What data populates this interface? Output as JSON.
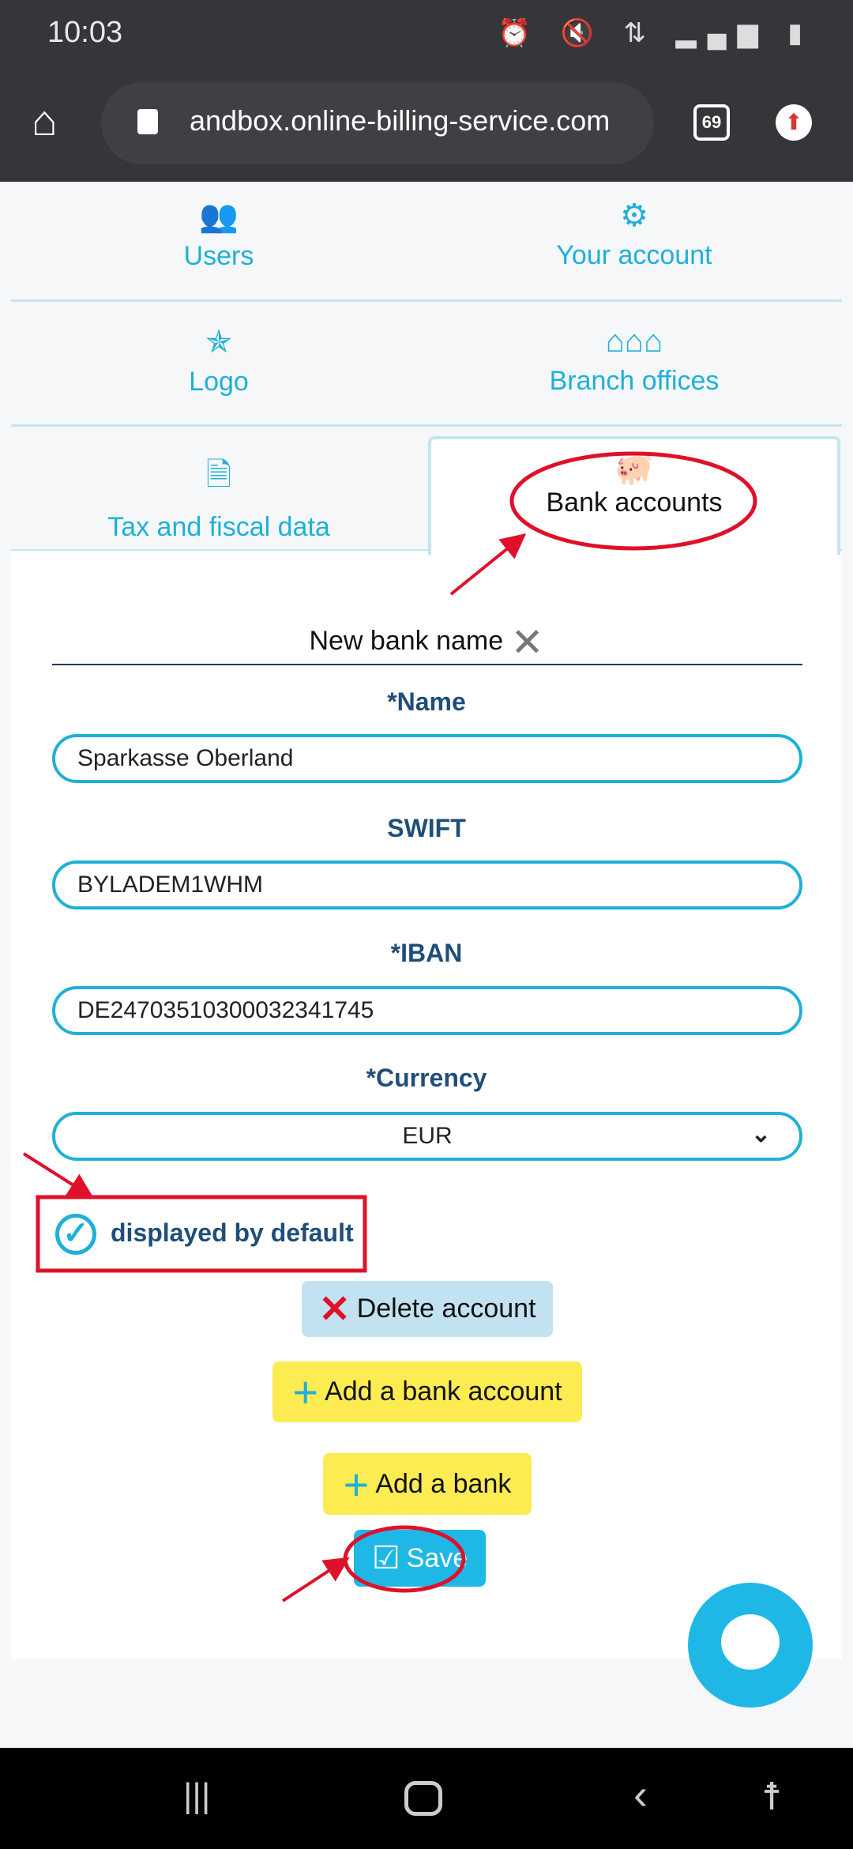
{
  "status_bar": {
    "time": "10:03",
    "icons": [
      "person-icon",
      "alarm-icon",
      "mute-icon",
      "network-icon",
      "signal-icon",
      "battery-icon"
    ]
  },
  "browser": {
    "url": "andbox.online-billing-service.com",
    "tab_count": "69"
  },
  "tabs": [
    {
      "label": "Users",
      "icon": "users-icon"
    },
    {
      "label": "Your account",
      "icon": "gear-user-icon"
    },
    {
      "label": "Logo",
      "icon": "logo-star-icon"
    },
    {
      "label": "Branch offices",
      "icon": "houses-icon"
    },
    {
      "label": "Tax and fiscal data",
      "icon": "document-icon"
    },
    {
      "label": "Bank accounts",
      "icon": "piggy-bank-icon",
      "active": true
    }
  ],
  "form": {
    "bank_title": "New bank name",
    "name_label": "*Name",
    "name_value": "Sparkasse Oberland",
    "swift_label": "SWIFT",
    "swift_value": "BYLADEM1WHM",
    "iban_label": "*IBAN",
    "iban_value": "DE24703510300032341745",
    "currency_label": "*Currency",
    "currency_value": "EUR",
    "default_label": "displayed by default",
    "default_checked": true
  },
  "buttons": {
    "delete": "Delete account",
    "add_account": "Add a bank account",
    "add_bank": "Add a bank",
    "save": "Save"
  },
  "colors": {
    "accent": "#1fb0d8",
    "label": "#1f4e79",
    "yellow": "#fdeb52",
    "annotation": "#e0102a"
  }
}
